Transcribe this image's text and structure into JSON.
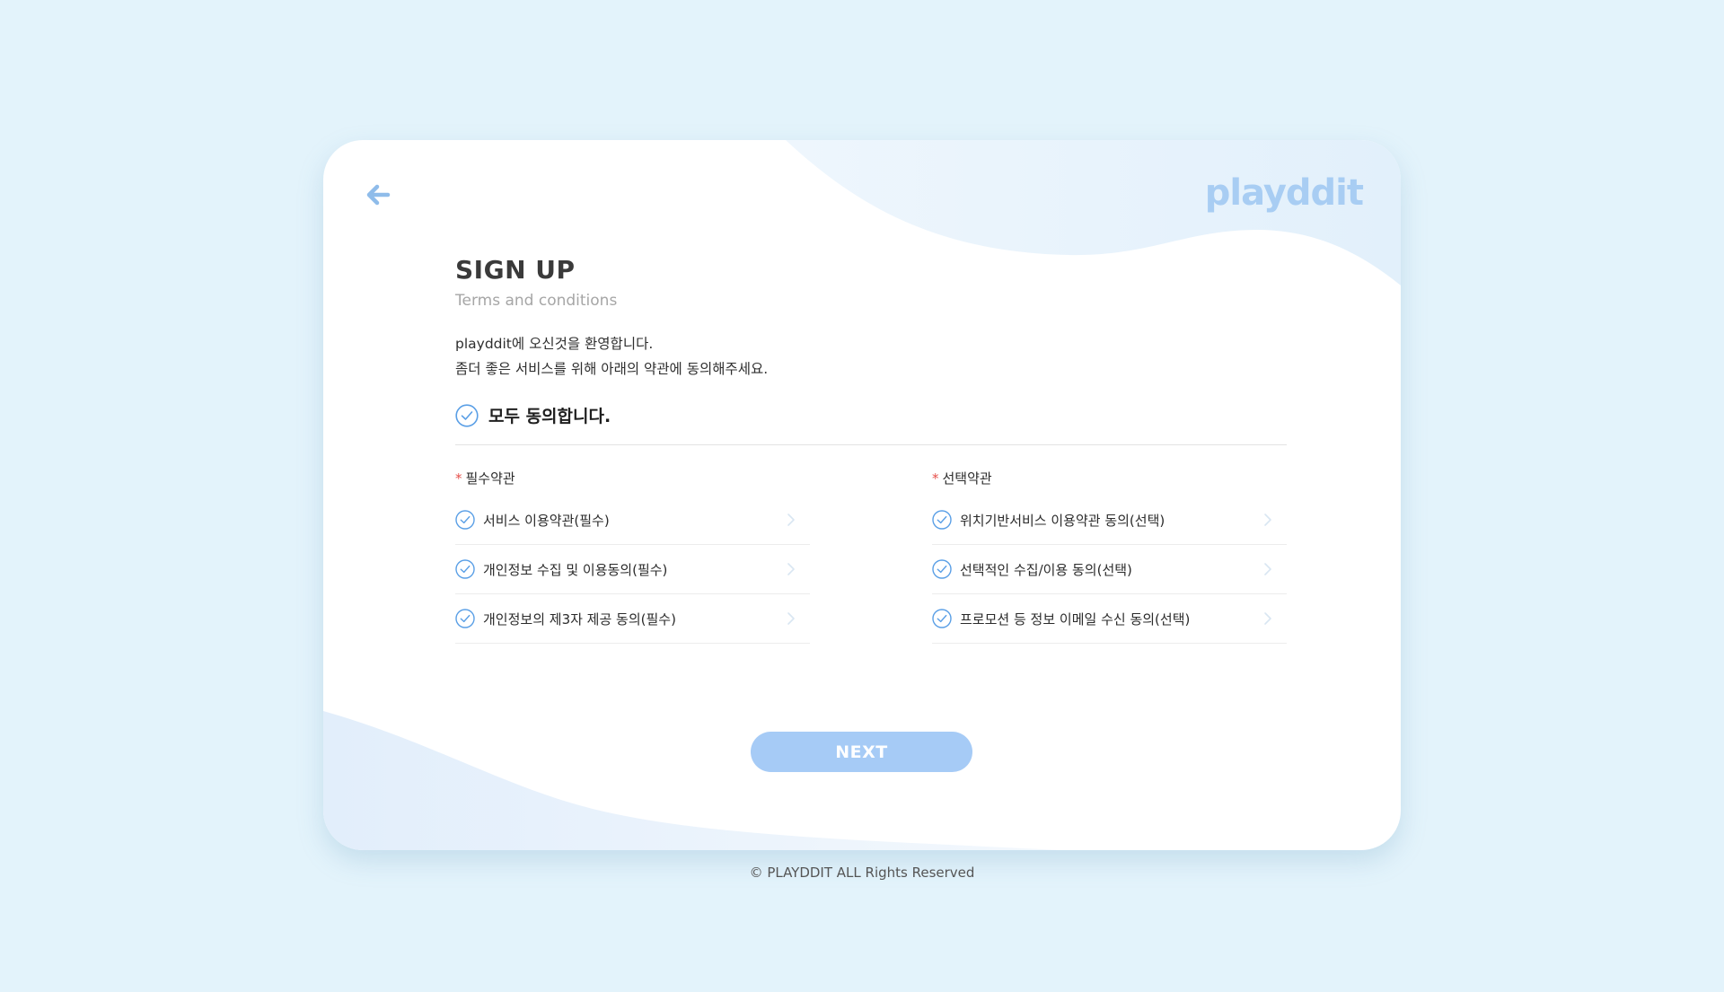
{
  "brand": {
    "logo_text": "playddit",
    "logo_color": "#a8cdf3"
  },
  "nav": {
    "back_icon": "arrow-left-icon"
  },
  "page": {
    "title": "SIGN UP",
    "subtitle": "Terms and conditions",
    "welcome_line1": "playddit에 오신것을 환영합니다.",
    "welcome_line2": "좀더 좋은 서비스를 위해 아래의 약관에 동의해주세요."
  },
  "agree_all": {
    "label": "모두 동의합니다.",
    "checked": true
  },
  "required_terms": {
    "title": "필수약관",
    "items": [
      {
        "label": "서비스 이용약관(필수)",
        "checked": true
      },
      {
        "label": "개인정보 수집 및 이용동의(필수)",
        "checked": true
      },
      {
        "label": "개인정보의 제3자 제공 동의(필수)",
        "checked": true
      }
    ]
  },
  "optional_terms": {
    "title": "선택약관",
    "items": [
      {
        "label": "위치기반서비스 이용약관 동의(선택)",
        "checked": true
      },
      {
        "label": "선택적인 수집/이용 동의(선택)",
        "checked": true
      },
      {
        "label": "프로모션 등 정보 이메일 수신 동의(선택)",
        "checked": true
      }
    ]
  },
  "actions": {
    "next_label": "NEXT"
  },
  "footer": {
    "copyright": "© PLAYDDIT ALL Rights Reserved"
  },
  "colors": {
    "background": "#e3f3fb",
    "accent": "#5a9fe6",
    "button": "#a6cbf6",
    "required_star": "#e6504b"
  }
}
